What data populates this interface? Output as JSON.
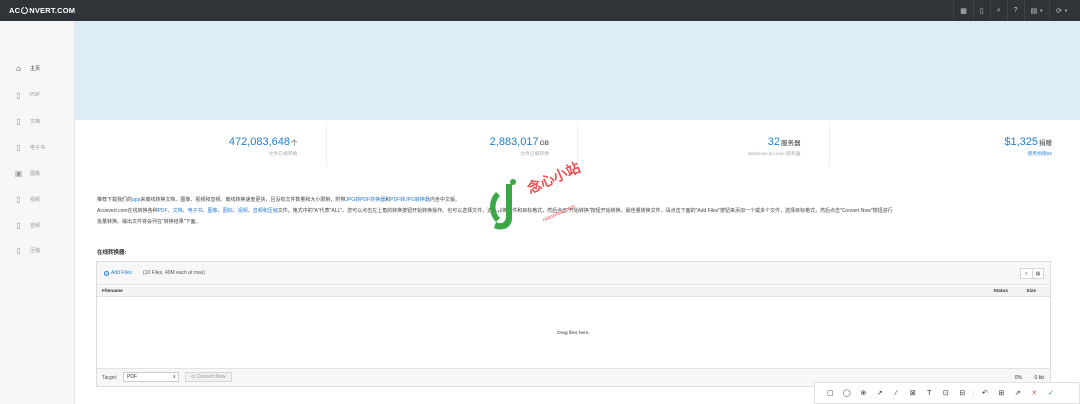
{
  "header": {
    "logo_left": "AC",
    "logo_right": "NVERT.COM",
    "icons": [
      "grid-icon",
      "bookmark-icon",
      "search-icon",
      "help-icon",
      "language-icon",
      "refresh-icon"
    ]
  },
  "sidebar": {
    "items": [
      {
        "label": "主页",
        "icon": "home-icon",
        "glyph": "⌂"
      },
      {
        "label": "PDF",
        "icon": "pdf-file-icon",
        "glyph": "▯"
      },
      {
        "label": "文档",
        "icon": "document-icon",
        "glyph": "▯"
      },
      {
        "label": "电子书",
        "icon": "ebook-icon",
        "glyph": "▯"
      },
      {
        "label": "图像",
        "icon": "image-icon",
        "glyph": "▣"
      },
      {
        "label": "视频",
        "icon": "video-icon",
        "glyph": "▯"
      },
      {
        "label": "音频",
        "icon": "audio-icon",
        "glyph": "▯"
      },
      {
        "label": "压缩",
        "icon": "archive-icon",
        "glyph": "▯"
      }
    ]
  },
  "stats": [
    {
      "num": "472,083,648",
      "unit": "个",
      "sub": "文件已被转换"
    },
    {
      "num": "2,883,017",
      "unit": "GB",
      "sub": "文件已被转换"
    },
    {
      "num": "32",
      "unit": "服务器",
      "sub": "Windows & Linux 服务器"
    },
    {
      "num": "$1,325",
      "unit": "捐赠",
      "sub": "使用捐赠$5"
    }
  ],
  "description": {
    "line1_a": "推荐下载我们的",
    "line1_link": "app",
    "line1_b": "来离线转换文档、图像、视频和音频。离线转换速度更快，且没有文件数量和大小限制，附带",
    "line1_link2": "JPG转PDF转换器",
    "line1_c": "和",
    "line1_link3": "PDF转JPG转换器",
    "line1_d": "内含中文版。",
    "line2_a": "Aconvert.com在线转换各种",
    "line2_links": [
      "PDF",
      "文档",
      "电子书",
      "图像",
      "图标",
      "视频",
      "音频和压缩"
    ],
    "line2_b": "文件。格式中的\"A\"代表\"ALL\"。您可以点击左上角的转换按钮开始转换操作。也可以选择文件，选择转换文件和目标格式，然后点击\"开始转换\"按钮开始转换。最佳量转换文件，请点击下面的\"Add Files\"按钮来添加一个或多个文件，选择目标格式，然后点击\"Convert Now\"按钮进行",
    "line3": "批量转换。输出文件将会列在\"转换结果\"下面。"
  },
  "converter": {
    "title": "在线转换器:",
    "add_files": "Add Files",
    "add_hint": "(10 Files, 40M each at max)",
    "col_filename": "Filename",
    "col_status": "Status",
    "col_size": "Size",
    "drop_text": "Drag files here.",
    "target_label": "Target:",
    "target_value": "PDF",
    "convert_button": "Convert Now",
    "percent": "0%",
    "size": "0 kb"
  },
  "watermark": {
    "text": "念心小站",
    "sub": "nianxinxz.com"
  },
  "annotation_toolbar": {
    "tools": [
      "▢",
      "◯",
      "⊕",
      "↗",
      "⁄",
      "⊠",
      "⊡",
      "⊟",
      "↶",
      "⊞",
      "⇗",
      "✕",
      "✓"
    ]
  }
}
